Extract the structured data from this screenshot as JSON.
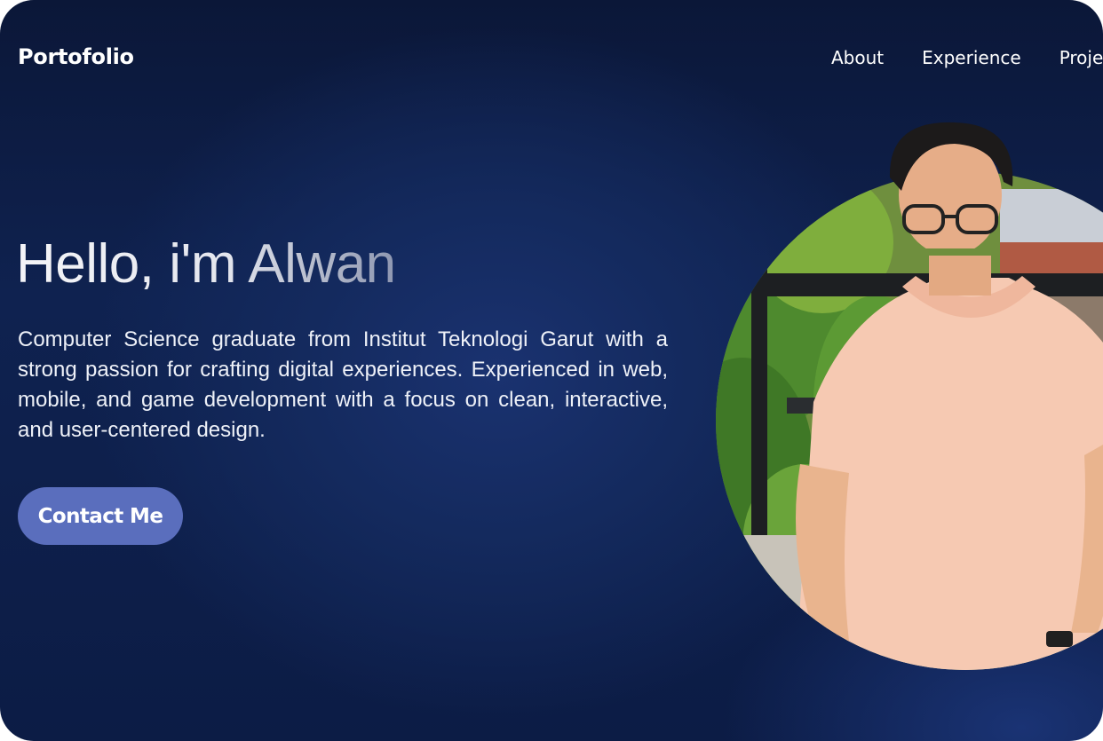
{
  "header": {
    "logo": "Portofolio",
    "nav": [
      "About",
      "Experience",
      "Proje"
    ]
  },
  "hero": {
    "title": "Hello, i'm Alwan",
    "description": "Computer Science graduate from Institut Teknologi Garut with a strong passion for crafting digital experiences. Experienced in web, mobile, and game development with a focus on clean, interactive, and user-centered design.",
    "cta_label": "Contact Me",
    "photo_icon": "profile-photo"
  },
  "colors": {
    "background": "#0f2250",
    "accent": "#5a6ebd",
    "text": "#ffffff"
  }
}
